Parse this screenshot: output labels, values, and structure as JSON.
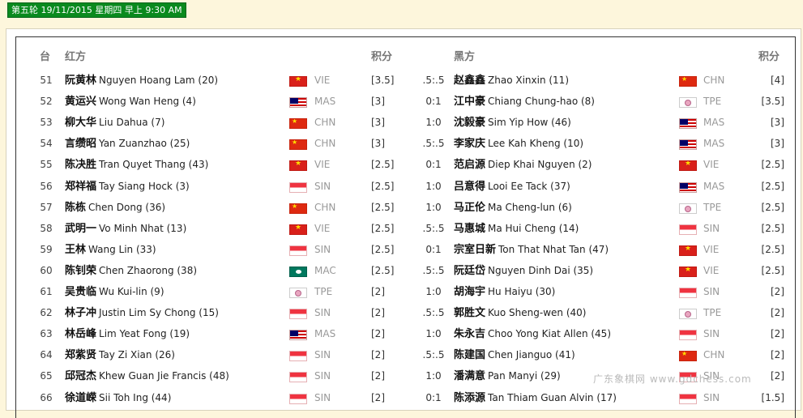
{
  "round_badge": "第五轮 19/11/2015 星期四 早上 9:30 AM",
  "headers": {
    "table": "台",
    "red": "红方",
    "red_score": "积分",
    "black": "黑方",
    "black_score": "积分"
  },
  "watermark": "广东象棋网 www.gdchess.com",
  "rows": [
    {
      "table": "51",
      "red_cn": "阮黄林",
      "red_en": "Nguyen Hoang Lam (20)",
      "red_flag": "vie",
      "red_country": "VIE",
      "red_score": "[3.5]",
      "result": ".5:.5",
      "black_cn": "赵鑫鑫",
      "black_en": "Zhao Xinxin (11)",
      "black_flag": "chn",
      "black_country": "CHN",
      "black_score": "[4]"
    },
    {
      "table": "52",
      "red_cn": "黄运兴",
      "red_en": "Wong Wan Heng (4)",
      "red_flag": "mas",
      "red_country": "MAS",
      "red_score": "[3]",
      "result": "0:1",
      "black_cn": "江中豪",
      "black_en": "Chiang Chung-hao (8)",
      "black_flag": "tpe",
      "black_country": "TPE",
      "black_score": "[3.5]"
    },
    {
      "table": "53",
      "red_cn": "柳大华",
      "red_en": "Liu Dahua (7)",
      "red_flag": "chn",
      "red_country": "CHN",
      "red_score": "[3]",
      "result": "1:0",
      "black_cn": "沈毅豪",
      "black_en": "Sim Yip How (46)",
      "black_flag": "mas",
      "black_country": "MAS",
      "black_score": "[3]"
    },
    {
      "table": "54",
      "red_cn": "言缵昭",
      "red_en": "Yan Zuanzhao (25)",
      "red_flag": "chn",
      "red_country": "CHN",
      "red_score": "[3]",
      "result": ".5:.5",
      "black_cn": "李家庆",
      "black_en": "Lee Kah Kheng (10)",
      "black_flag": "mas",
      "black_country": "MAS",
      "black_score": "[3]"
    },
    {
      "table": "55",
      "red_cn": "陈决胜",
      "red_en": "Tran Quyet Thang (43)",
      "red_flag": "vie",
      "red_country": "VIE",
      "red_score": "[2.5]",
      "result": "0:1",
      "black_cn": "范启源",
      "black_en": "Diep Khai Nguyen (2)",
      "black_flag": "vie",
      "black_country": "VIE",
      "black_score": "[2.5]"
    },
    {
      "table": "56",
      "red_cn": "郑祥福",
      "red_en": "Tay Siang Hock (3)",
      "red_flag": "sin",
      "red_country": "SIN",
      "red_score": "[2.5]",
      "result": "1:0",
      "black_cn": "吕意得",
      "black_en": "Looi Ee Tack (37)",
      "black_flag": "mas",
      "black_country": "MAS",
      "black_score": "[2.5]"
    },
    {
      "table": "57",
      "red_cn": "陈栋",
      "red_en": "Chen Dong (36)",
      "red_flag": "chn",
      "red_country": "CHN",
      "red_score": "[2.5]",
      "result": "1:0",
      "black_cn": "马正伦",
      "black_en": "Ma Cheng-lun (6)",
      "black_flag": "tpe",
      "black_country": "TPE",
      "black_score": "[2.5]"
    },
    {
      "table": "58",
      "red_cn": "武明一",
      "red_en": "Vo Minh Nhat (13)",
      "red_flag": "vie",
      "red_country": "VIE",
      "red_score": "[2.5]",
      "result": ".5:.5",
      "black_cn": "马惠城",
      "black_en": "Ma Hui Cheng (14)",
      "black_flag": "sin",
      "black_country": "SIN",
      "black_score": "[2.5]"
    },
    {
      "table": "59",
      "red_cn": "王林",
      "red_en": "Wang Lin (33)",
      "red_flag": "sin",
      "red_country": "SIN",
      "red_score": "[2.5]",
      "result": "0:1",
      "black_cn": "宗室日新",
      "black_en": "Ton That Nhat Tan (47)",
      "black_flag": "vie",
      "black_country": "VIE",
      "black_score": "[2.5]"
    },
    {
      "table": "60",
      "red_cn": "陈钊荣",
      "red_en": "Chen Zhaorong (38)",
      "red_flag": "mac",
      "red_country": "MAC",
      "red_score": "[2.5]",
      "result": ".5:.5",
      "black_cn": "阮廷岱",
      "black_en": "Nguyen Dinh Dai (35)",
      "black_flag": "vie",
      "black_country": "VIE",
      "black_score": "[2.5]"
    },
    {
      "table": "61",
      "red_cn": "吴贵临",
      "red_en": "Wu Kui-lin (9)",
      "red_flag": "tpe",
      "red_country": "TPE",
      "red_score": "[2]",
      "result": "1:0",
      "black_cn": "胡海宇",
      "black_en": "Hu Haiyu (30)",
      "black_flag": "sin",
      "black_country": "SIN",
      "black_score": "[2]"
    },
    {
      "table": "62",
      "red_cn": "林子冲",
      "red_en": "Justin Lim Sy Chong (15)",
      "red_flag": "sin",
      "red_country": "SIN",
      "red_score": "[2]",
      "result": ".5:.5",
      "black_cn": "郭胜文",
      "black_en": "Kuo Sheng-wen (40)",
      "black_flag": "tpe",
      "black_country": "TPE",
      "black_score": "[2]"
    },
    {
      "table": "63",
      "red_cn": "林岳峰",
      "red_en": "Lim Yeat Fong (19)",
      "red_flag": "mas",
      "red_country": "MAS",
      "red_score": "[2]",
      "result": "1:0",
      "black_cn": "朱永吉",
      "black_en": "Choo Yong Kiat Allen (45)",
      "black_flag": "sin",
      "black_country": "SIN",
      "black_score": "[2]"
    },
    {
      "table": "64",
      "red_cn": "郑紫贤",
      "red_en": "Tay Zi Xian (26)",
      "red_flag": "sin",
      "red_country": "SIN",
      "red_score": "[2]",
      "result": ".5:.5",
      "black_cn": "陈建国",
      "black_en": "Chen Jianguo (41)",
      "black_flag": "chn",
      "black_country": "CHN",
      "black_score": "[2]"
    },
    {
      "table": "65",
      "red_cn": "邱冠杰",
      "red_en": "Khew Guan Jie Francis (48)",
      "red_flag": "sin",
      "red_country": "SIN",
      "red_score": "[2]",
      "result": "1:0",
      "black_cn": "潘满意",
      "black_en": "Pan Manyi (29)",
      "black_flag": "sin",
      "black_country": "SIN",
      "black_score": "[2]"
    },
    {
      "table": "66",
      "red_cn": "徐道嵘",
      "red_en": "Sii Toh Ing (44)",
      "red_flag": "sin",
      "red_country": "SIN",
      "red_score": "[2]",
      "result": "0:1",
      "black_cn": "陈添源",
      "black_en": "Tan Thiam Guan Alvin (17)",
      "black_flag": "sin",
      "black_country": "SIN",
      "black_score": "[1.5]"
    }
  ]
}
